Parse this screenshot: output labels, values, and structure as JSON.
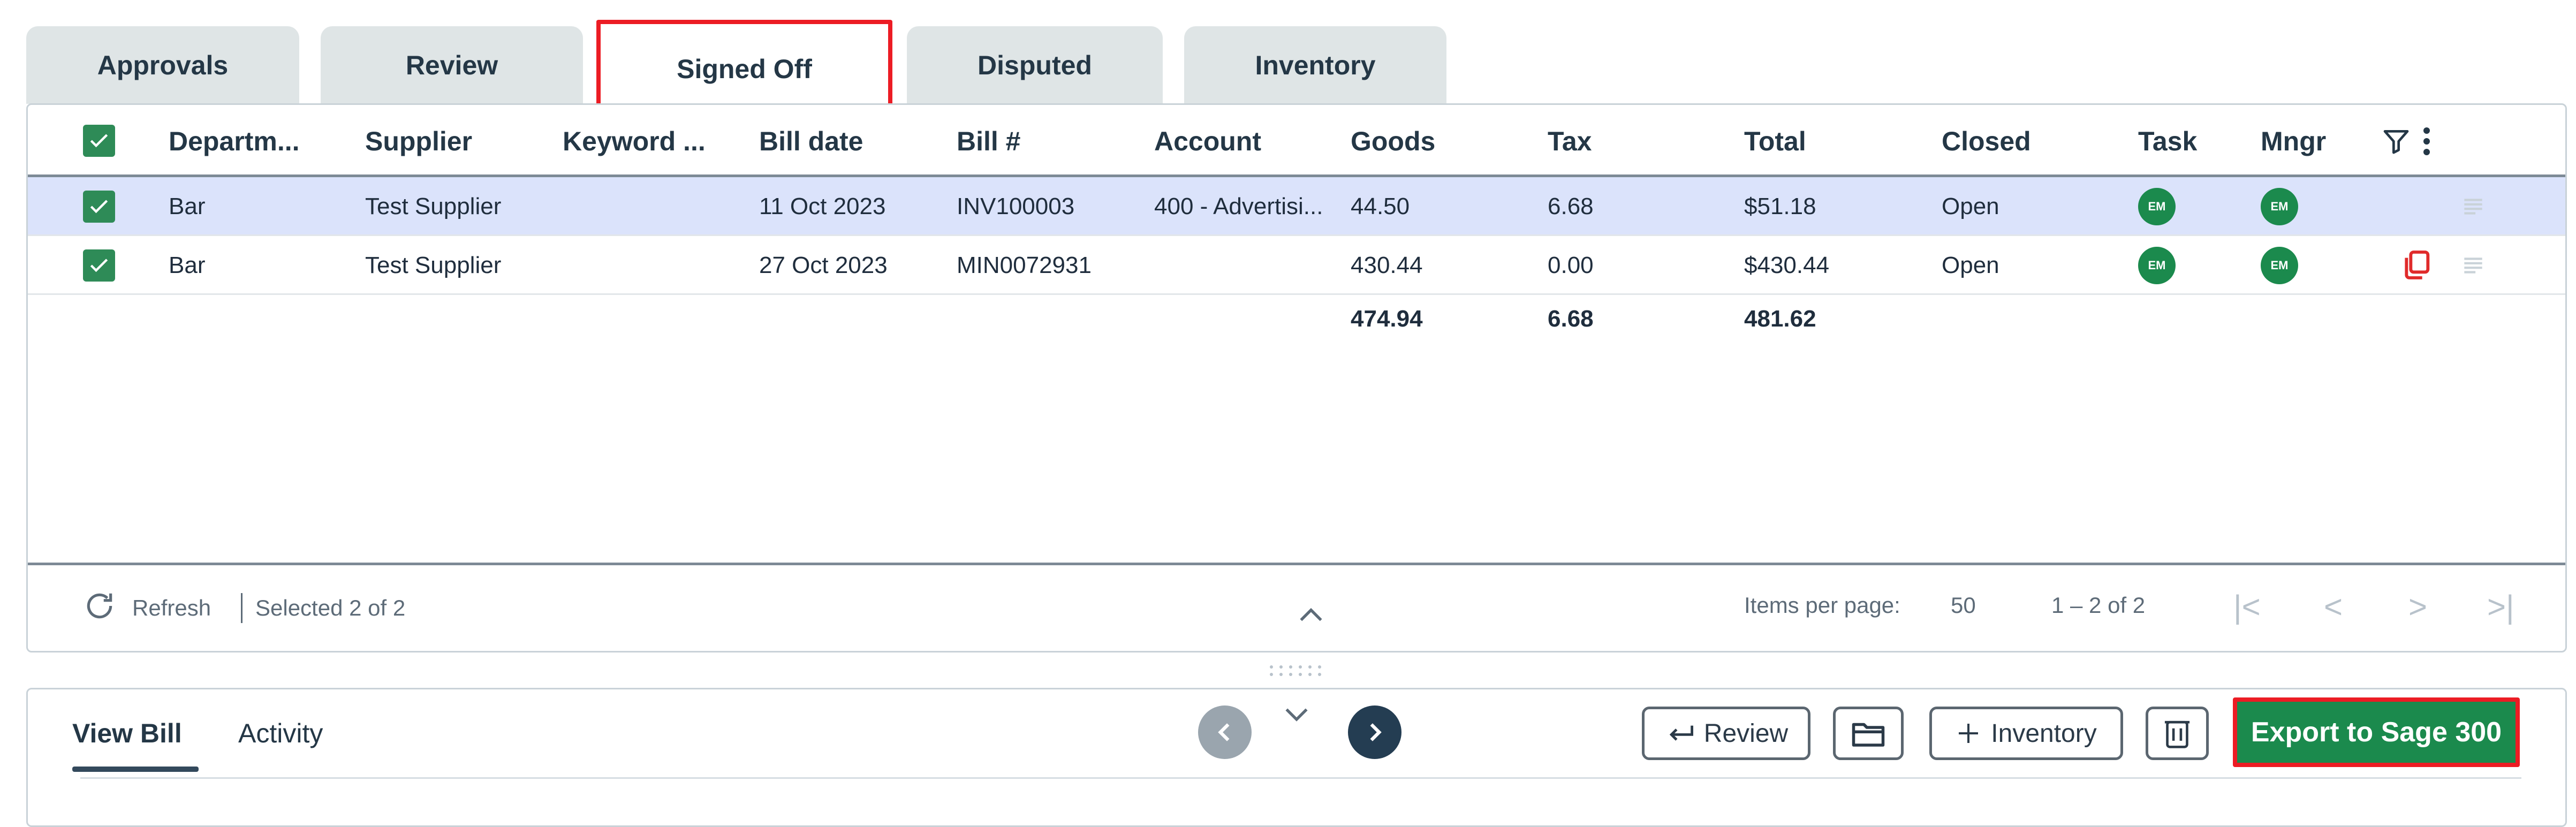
{
  "tabs": [
    {
      "label": "Approvals"
    },
    {
      "label": "Review"
    },
    {
      "label": "Signed Off"
    },
    {
      "label": "Disputed"
    },
    {
      "label": "Inventory"
    }
  ],
  "grid": {
    "columns": [
      "Departm...",
      "Supplier",
      "Keyword ...",
      "Bill date",
      "Bill #",
      "Account",
      "Goods",
      "Tax",
      "Total",
      "Closed",
      "Task",
      "Mngr"
    ],
    "rows": [
      {
        "department": "Bar",
        "supplier": "Test Supplier",
        "keyword": "",
        "bill_date": "11 Oct 2023",
        "bill_no": "INV100003",
        "account": "400 - Advertisi...",
        "goods": "44.50",
        "tax": "6.68",
        "total": "$51.18",
        "closed": "Open",
        "task": "EM",
        "mngr": "EM",
        "selected": true
      },
      {
        "department": "Bar",
        "supplier": "Test Supplier",
        "keyword": "",
        "bill_date": "27 Oct 2023",
        "bill_no": "MIN0072931",
        "account": "",
        "goods": "430.44",
        "tax": "0.00",
        "total": "$430.44",
        "closed": "Open",
        "task": "EM",
        "mngr": "EM",
        "selected": true
      }
    ],
    "totals": {
      "goods": "474.94",
      "tax": "6.68",
      "total": "481.62"
    }
  },
  "footer": {
    "refresh": "Refresh",
    "selected": "Selected 2 of 2",
    "items_per_page_label": "Items per page:",
    "items_per_page": "50",
    "range": "1 – 2 of 2"
  },
  "bottom": {
    "tabs": [
      "View Bill",
      "Activity"
    ],
    "buttons": {
      "review": "Review",
      "inventory": "Inventory",
      "export": "Export to Sage 300"
    }
  },
  "colors": {
    "accent": "#1b8a4d",
    "highlight": "#ec1c24",
    "selected_row": "#dbe3fb"
  }
}
